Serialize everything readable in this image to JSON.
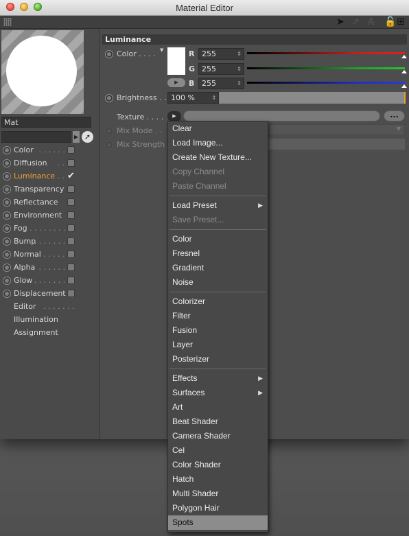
{
  "window": {
    "title": "Material Editor"
  },
  "preview": {
    "material_name": "Mat"
  },
  "channels": [
    {
      "label": "Color",
      "dots": ". . . . . . .",
      "has_radio": true,
      "checked": false,
      "active": false
    },
    {
      "label": "Diffusion",
      "dots": ". . . .",
      "has_radio": true,
      "checked": false,
      "active": false
    },
    {
      "label": "Luminance",
      "dots": ". .",
      "has_radio": true,
      "checked": true,
      "active": true
    },
    {
      "label": "Transparency",
      "dots": "",
      "has_radio": true,
      "checked": false,
      "active": false
    },
    {
      "label": "Reflectance",
      "dots": ". .",
      "has_radio": true,
      "checked": false,
      "active": false
    },
    {
      "label": "Environment",
      "dots": "",
      "has_radio": true,
      "checked": false,
      "active": false
    },
    {
      "label": "Fog",
      "dots": ". . . . . . . . .",
      "has_radio": true,
      "checked": false,
      "active": false
    },
    {
      "label": "Bump",
      "dots": ". . . . . . .",
      "has_radio": true,
      "checked": false,
      "active": false
    },
    {
      "label": "Normal",
      "dots": ". . . . .",
      "has_radio": true,
      "checked": false,
      "active": false
    },
    {
      "label": "Alpha",
      "dots": ". . . . . .",
      "has_radio": true,
      "checked": false,
      "active": false
    },
    {
      "label": "Glow",
      "dots": ". . . . . . .",
      "has_radio": true,
      "checked": false,
      "active": false
    },
    {
      "label": "Displacement",
      "dots": "",
      "has_radio": true,
      "checked": false,
      "active": false
    },
    {
      "label": "Editor",
      "dots": ". . . . . . .",
      "has_radio": false,
      "checked": false,
      "active": false
    },
    {
      "label": "Illumination",
      "dots": "",
      "has_radio": false,
      "checked": false,
      "active": false
    },
    {
      "label": "Assignment",
      "dots": "",
      "has_radio": false,
      "checked": false,
      "active": false
    }
  ],
  "luminance": {
    "header": "Luminance",
    "color_label": "Color . . . .",
    "r_label": "R",
    "g_label": "G",
    "b_label": "B",
    "r_value": "255",
    "g_value": "255",
    "b_value": "255",
    "brightness_label": "Brightness . .",
    "brightness_value": "100 %",
    "texture_label": "Texture . . . .",
    "texture_more": "...",
    "mix_mode_label": "Mix Mode . .",
    "mix_strength_label": "Mix Strength"
  },
  "context_menu": {
    "groups": [
      [
        {
          "label": "Clear",
          "disabled": false,
          "submenu": false
        },
        {
          "label": "Load Image...",
          "disabled": false,
          "submenu": false
        },
        {
          "label": "Create New Texture...",
          "disabled": false,
          "submenu": false
        },
        {
          "label": "Copy Channel",
          "disabled": true,
          "submenu": false
        },
        {
          "label": "Paste Channel",
          "disabled": true,
          "submenu": false
        }
      ],
      [
        {
          "label": "Load Preset",
          "disabled": false,
          "submenu": true
        },
        {
          "label": "Save Preset...",
          "disabled": true,
          "submenu": false
        }
      ],
      [
        {
          "label": "Color",
          "disabled": false,
          "submenu": false
        },
        {
          "label": "Fresnel",
          "disabled": false,
          "submenu": false
        },
        {
          "label": "Gradient",
          "disabled": false,
          "submenu": false
        },
        {
          "label": "Noise",
          "disabled": false,
          "submenu": false
        }
      ],
      [
        {
          "label": "Colorizer",
          "disabled": false,
          "submenu": false
        },
        {
          "label": "Filter",
          "disabled": false,
          "submenu": false
        },
        {
          "label": "Fusion",
          "disabled": false,
          "submenu": false
        },
        {
          "label": "Layer",
          "disabled": false,
          "submenu": false
        },
        {
          "label": "Posterizer",
          "disabled": false,
          "submenu": false
        }
      ],
      [
        {
          "label": "Effects",
          "disabled": false,
          "submenu": true
        },
        {
          "label": "Surfaces",
          "disabled": false,
          "submenu": true
        },
        {
          "label": "Art",
          "disabled": false,
          "submenu": false
        },
        {
          "label": "Beat Shader",
          "disabled": false,
          "submenu": false
        },
        {
          "label": "Camera Shader",
          "disabled": false,
          "submenu": false
        },
        {
          "label": "Cel",
          "disabled": false,
          "submenu": false
        },
        {
          "label": "Color Shader",
          "disabled": false,
          "submenu": false
        },
        {
          "label": "Hatch",
          "disabled": false,
          "submenu": false
        },
        {
          "label": "Multi Shader",
          "disabled": false,
          "submenu": false
        },
        {
          "label": "Polygon Hair",
          "disabled": false,
          "submenu": false
        },
        {
          "label": "Spots",
          "disabled": false,
          "submenu": false,
          "selected": true
        }
      ]
    ]
  },
  "colors": {
    "accent": "#f0a23a",
    "menu_bg": "#484848",
    "panel_bg": "#4d4d4d"
  }
}
